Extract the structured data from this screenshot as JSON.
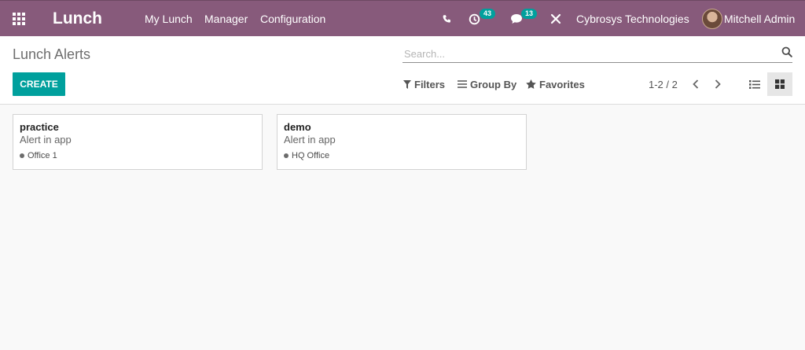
{
  "navbar": {
    "app_name": "Lunch",
    "menu": [
      "My Lunch",
      "Manager",
      "Configuration"
    ],
    "activity_count": "43",
    "message_count": "13",
    "company": "Cybrosys Technologies",
    "user": "Mitchell Admin",
    "colors": {
      "bar": "#875a7b",
      "badge": "#00a09d"
    }
  },
  "control_panel": {
    "breadcrumb": "Lunch Alerts",
    "search_placeholder": "Search...",
    "create_label": "CREATE",
    "filters_label": "Filters",
    "groupby_label": "Group By",
    "favorites_label": "Favorites",
    "pager": "1-2 / 2",
    "active_view": "kanban"
  },
  "kanban": {
    "cards": [
      {
        "name": "practice",
        "mode": "Alert in app",
        "location": "Office 1"
      },
      {
        "name": "demo",
        "mode": "Alert in app",
        "location": "HQ Office"
      }
    ]
  }
}
